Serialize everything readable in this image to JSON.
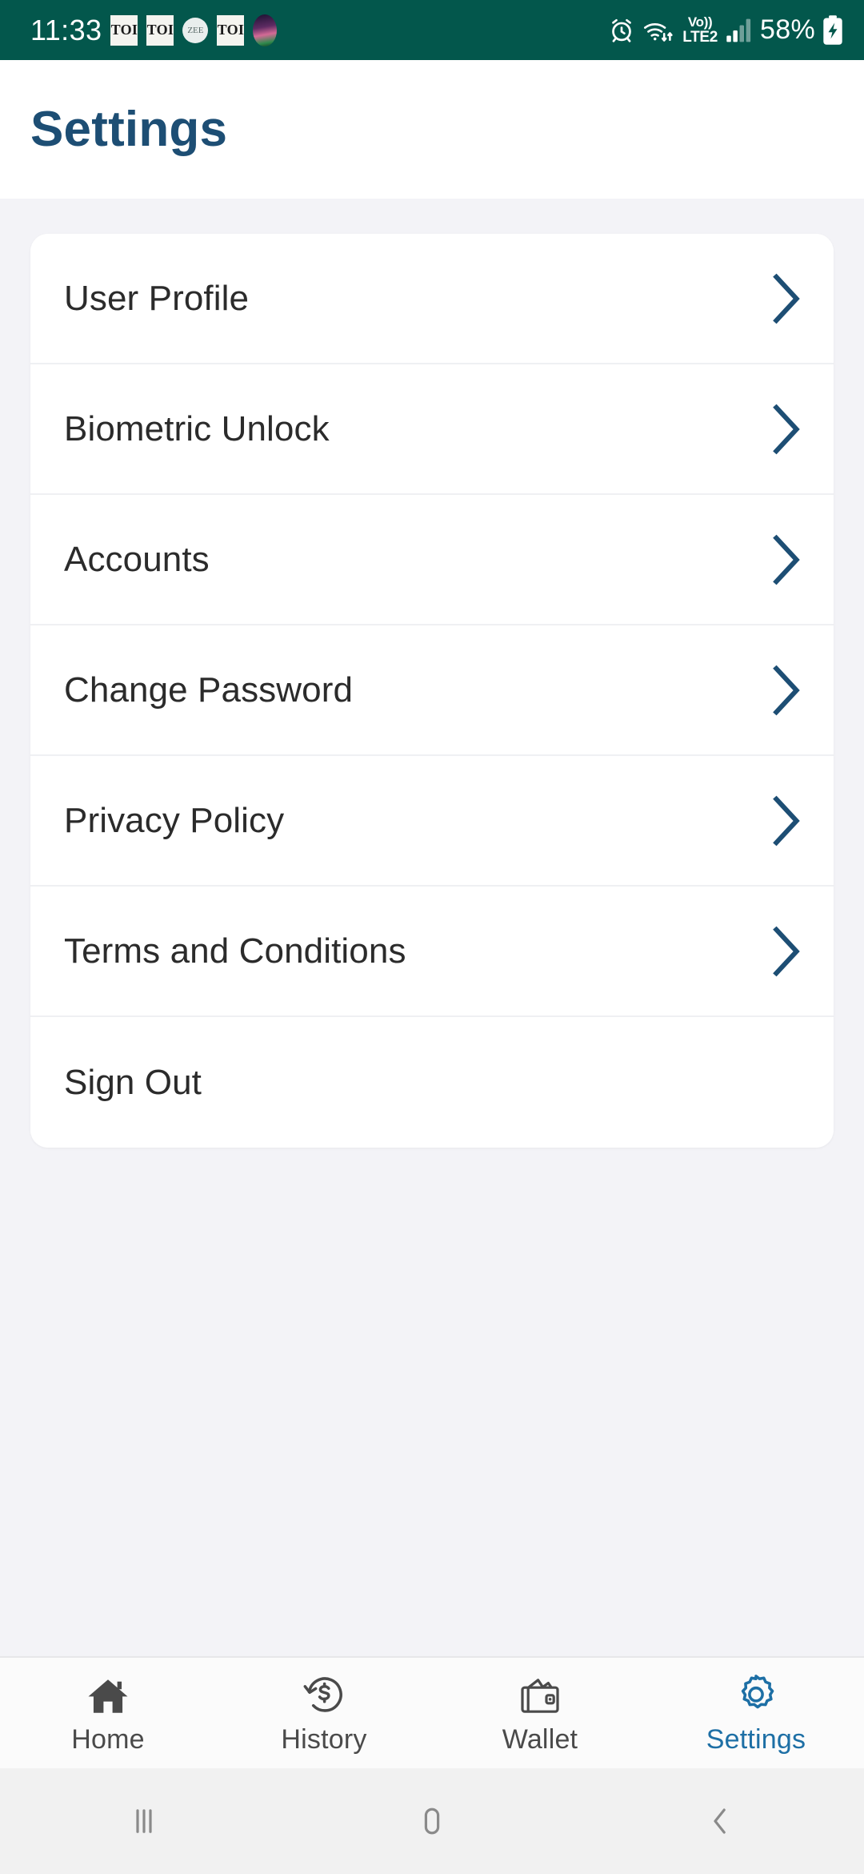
{
  "statusbar": {
    "time": "11:33",
    "notifications": [
      {
        "name": "toi-notification-icon-1",
        "label": "TOI"
      },
      {
        "name": "toi-notification-icon-2",
        "label": "TOI"
      },
      {
        "name": "zee-notification-icon",
        "label": "ZEE"
      },
      {
        "name": "toi-notification-icon-3",
        "label": "TOI"
      },
      {
        "name": "app-avatar-notification-icon",
        "label": ""
      }
    ],
    "alarm_icon": "alarm-icon",
    "wifi_icon": "wifi-data-transfer-icon",
    "volte_line1": "Vo))",
    "volte_line2": "LTE2",
    "signal_icon": "cellular-signal-icon",
    "battery_percent": "58%",
    "battery_icon": "battery-charging-icon",
    "background_color": "#03574c"
  },
  "header": {
    "title": "Settings",
    "title_color": "#1d4e74"
  },
  "settings_list": [
    {
      "label": "User Profile",
      "chevron": true,
      "name": "settings-row-user-profile"
    },
    {
      "label": "Biometric Unlock",
      "chevron": true,
      "name": "settings-row-biometric-unlock"
    },
    {
      "label": "Accounts",
      "chevron": true,
      "name": "settings-row-accounts"
    },
    {
      "label": "Change Password",
      "chevron": true,
      "name": "settings-row-change-password"
    },
    {
      "label": "Privacy Policy",
      "chevron": true,
      "name": "settings-row-privacy-policy"
    },
    {
      "label": "Terms and Conditions",
      "chevron": true,
      "name": "settings-row-terms-and-conditions"
    },
    {
      "label": "Sign Out",
      "chevron": false,
      "name": "settings-row-sign-out"
    }
  ],
  "tabbar": {
    "active_color": "#1d6fa5",
    "inactive_color": "#4a4a4a",
    "tabs": [
      {
        "label": "Home",
        "icon": "home-icon",
        "active": false
      },
      {
        "label": "History",
        "icon": "history-dollar-icon",
        "active": false
      },
      {
        "label": "Wallet",
        "icon": "wallet-icon",
        "active": false
      },
      {
        "label": "Settings",
        "icon": "gear-icon",
        "active": true
      }
    ]
  },
  "navbar": {
    "recents": "recents-icon",
    "home": "home-pill-icon",
    "back": "back-chevron-icon"
  }
}
